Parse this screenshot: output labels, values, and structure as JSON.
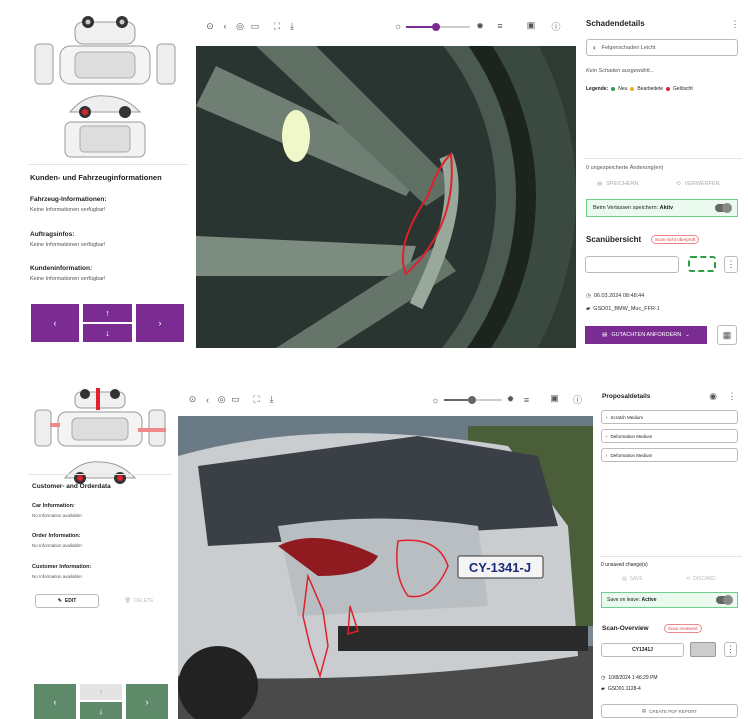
{
  "top": {
    "left": {
      "section_title": "Kunden- und Fahrzeuginformationen",
      "car_label": "Fahrzeug-Informationen:",
      "car_value": "Keine Informationen verfügbar!",
      "order_label": "Auftragsinfos:",
      "order_value": "Keine Informationen verfügbar!",
      "customer_label": "Kundeninformation:",
      "customer_value": "Keine Informationen verfügbar!"
    },
    "panel": {
      "title": "Schadendetails",
      "damage_item": "Felgenschaden Leicht",
      "no_damage": "Kein Schaden ausgewählt...",
      "legend_label": "Legende:",
      "legend_new": "Neu",
      "legend_edited": "Bearbeitete",
      "legend_deleted": "Gelöscht",
      "unsaved": "0 ungespeicherte Änderung(en)",
      "save": "SPEICHERN",
      "discard": "VERWERFEN",
      "autosave_label": "Beim Verlassen speichern:",
      "autosave_state": "Aktiv",
      "overview_title": "Scanübersicht",
      "overview_chip": "Scan nicht überprüft",
      "timestamp": "06.03.2024 08:48:44",
      "device": "GSD01_BMW_Muc_FFR-1",
      "request_button": "GUTACHTEN ANFORDERN"
    }
  },
  "bottom": {
    "left": {
      "section_title": "Customer- and Orderdata",
      "car_label": "Car Information:",
      "car_value": "No Information available!",
      "order_label": "Order Information:",
      "order_value": "No Information available!",
      "customer_label": "Customer Information:",
      "customer_value": "No Information available!",
      "edit": "EDIT",
      "delete": "DELETE"
    },
    "panel": {
      "title": "Proposaldetails",
      "items": [
        "Scratch Medium",
        "Deformation Medium",
        "Deformation Medium"
      ],
      "unsaved": "0 unsaved change(s)",
      "save": "SAVE",
      "discard": "DISCARD",
      "autosave_label": "Save on leave:",
      "autosave_state": "Active",
      "overview_title": "Scan-Overview",
      "overview_chip": "Scan reviewed",
      "plate": "CY1341J",
      "timestamp": "10/8/2024 1:46:29 PM",
      "device": "GSD01.1128-4",
      "report_button": "CREATE PDF REPORT"
    },
    "plate_text": "CY-1341-J"
  },
  "colors": {
    "purple": "#7a2c93",
    "green_btn": "#5e8a6a",
    "damage_red": "#e0202a",
    "legend_new": "#2e9e4a",
    "legend_edited": "#e8b020",
    "legend_deleted": "#e02040"
  }
}
